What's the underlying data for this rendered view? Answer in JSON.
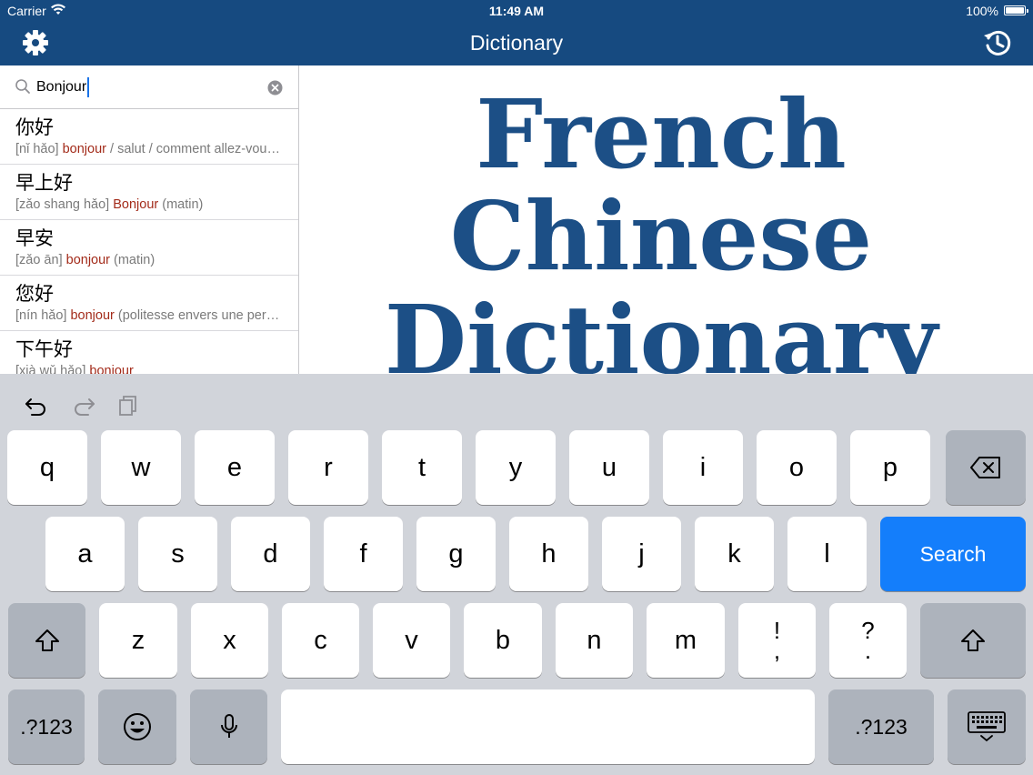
{
  "status": {
    "carrier": "Carrier",
    "time": "11:49 AM",
    "battery": "100%"
  },
  "nav": {
    "title": "Dictionary",
    "left_icon": "gear-icon",
    "right_icon": "history-icon"
  },
  "search": {
    "value": "Bonjour",
    "placeholder": ""
  },
  "results": [
    {
      "hanzi": "你好",
      "pinyin": "[nǐ hǎo]",
      "match": "bonjour",
      "rest": " / salut / comment allez-vous / enchanté"
    },
    {
      "hanzi": "早上好",
      "pinyin": "[zǎo shang hǎo]",
      "match": "Bonjour",
      "rest": " (matin)"
    },
    {
      "hanzi": "早安",
      "pinyin": "[zǎo ān]",
      "match": "bonjour",
      "rest": " (matin)"
    },
    {
      "hanzi": "您好",
      "pinyin": "[nín hǎo]",
      "match": "bonjour",
      "rest": " (politesse envers une personne)"
    },
    {
      "hanzi": "下午好",
      "pinyin": "[xià wǔ hǎo]",
      "match": "bonjour",
      "rest": ""
    }
  ],
  "logo": {
    "line1": "French",
    "line2": "Chinese",
    "line3": "Dictionary"
  },
  "keyboard": {
    "row1": [
      "q",
      "w",
      "e",
      "r",
      "t",
      "y",
      "u",
      "i",
      "o",
      "p"
    ],
    "row2": [
      "a",
      "s",
      "d",
      "f",
      "g",
      "h",
      "j",
      "k",
      "l"
    ],
    "row3": [
      "z",
      "x",
      "c",
      "v",
      "b",
      "n",
      "m"
    ],
    "punct1": {
      "top": "!",
      "bottom": ","
    },
    "punct2": {
      "top": "?",
      "bottom": "."
    },
    "search_label": "Search",
    "numbers_label": ".?123",
    "colors": {
      "accent": "#147efb",
      "navbar": "#164a80",
      "logo": "#1c4f86",
      "match": "#a32b1a"
    }
  }
}
